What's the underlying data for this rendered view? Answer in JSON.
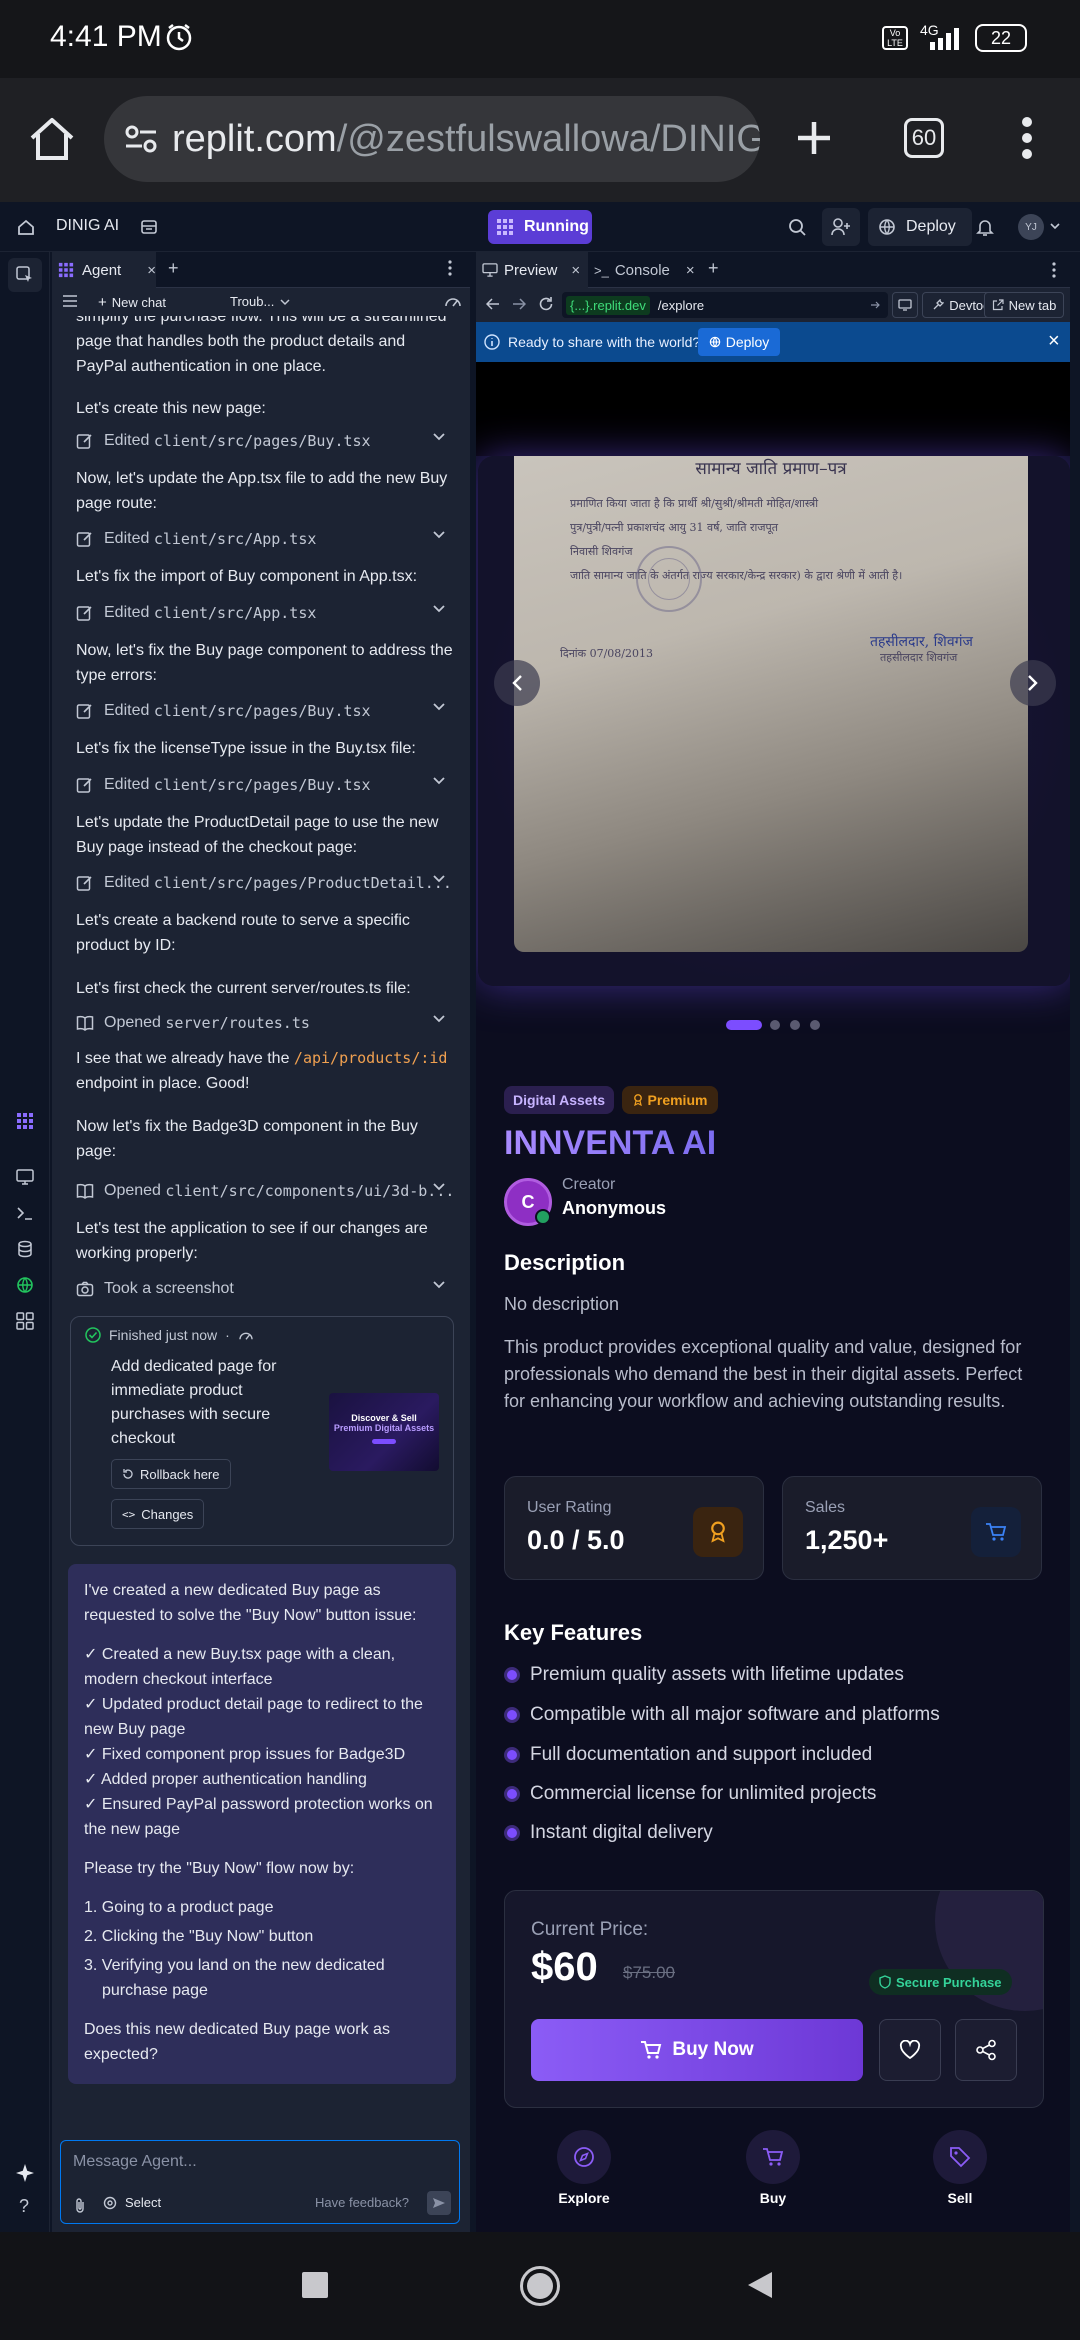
{
  "status_bar": {
    "time": "4:41 PM",
    "network": "4G",
    "battery": "22"
  },
  "browser": {
    "url_domain": "replit.com",
    "url_path": "/@zestfulswallowa/DINIG-",
    "tab_count": "60"
  },
  "replit": {
    "project_name": "DINIG AI",
    "run_status": "Running",
    "deploy_label": "Deploy",
    "avatar_initials": "YJ"
  },
  "agent": {
    "tab_label": "Agent",
    "new_chat": "New chat",
    "trouble": "Troub...",
    "intro_lines": [
      "simplify the purchase flow. This will be a streamlined",
      "page that handles both the product details and",
      "PayPal authentication in one place."
    ],
    "steps": [
      {
        "text": "Let's create this new page:",
        "action": "Edited",
        "file": "client/src/pages/Buy.tsx"
      },
      {
        "text": "Now, let's update the App.tsx file to add the new Buy page route:",
        "action": "Edited",
        "file": "client/src/App.tsx"
      },
      {
        "text": "Let's fix the import of Buy component in App.tsx:",
        "action": "Edited",
        "file": "client/src/App.tsx"
      },
      {
        "text": "Now, let's fix the Buy page component to address the type errors:",
        "action": "Edited",
        "file": "client/src/pages/Buy.tsx"
      },
      {
        "text": "Let's fix the licenseType issue in the Buy.tsx file:",
        "action": "Edited",
        "file": "client/src/pages/Buy.tsx"
      },
      {
        "text": "Let's update the ProductDetail page to use the new Buy page instead of the checkout page:",
        "action": "Edited",
        "file": "client/src/pages/ProductDetail..."
      },
      {
        "text": "Let's create a backend route to serve a specific product by ID:"
      },
      {
        "text": "Let's first check the current server/routes.ts file:",
        "action": "Opened",
        "file": "server/routes.ts"
      },
      {
        "text_before": "I see that we already have the",
        "code": "/api/products/:id",
        "text_after": "endpoint in place. Good!"
      },
      {
        "text": "Now let's fix the Badge3D component in the Buy page:",
        "action": "Opened",
        "file": "client/src/components/ui/3d-b..."
      },
      {
        "text": "Let's test the application to see if our changes are working properly:",
        "action": "Took a screenshot"
      }
    ],
    "checkpoint": {
      "status": "Finished just now",
      "title": "Add dedicated page for immediate product purchases with secure checkout",
      "thumb_title_1": "Discover & Sell",
      "thumb_title_2": "Premium Digital Assets",
      "rollback": "Rollback here",
      "changes": "Changes"
    },
    "summary": {
      "intro": "I've created a new dedicated Buy page as requested to solve the \"Buy Now\" button issue:",
      "checks": [
        "✓ Created a new Buy.tsx page with a clean, modern checkout interface",
        "✓ Updated product detail page to redirect to the new Buy page",
        "✓ Fixed component prop issues for Badge3D",
        "✓ Added proper authentication handling",
        "✓ Ensured PayPal password protection works on the new page"
      ],
      "try_intro": "Please try the \"Buy Now\" flow now by:",
      "try_steps": [
        "1. Going to a product page",
        "2. Clicking the \"Buy Now\" button",
        "3. Verifying you land on the new dedicated purchase page"
      ],
      "question": "Does this new dedicated Buy page work as expected?"
    },
    "input_placeholder": "Message Agent...",
    "select_label": "Select",
    "feedback": "Have feedback?"
  },
  "preview": {
    "tab_preview": "Preview",
    "tab_console": "Console",
    "url_host": "{...}.replit.dev",
    "url_path": "/explore",
    "devtools": "Devtools",
    "new_tab": "New tab",
    "banner_text": "Ready to share with the world?",
    "banner_button": "Deploy",
    "doc_heading": "सामान्य जाति प्रमाण–पत्र",
    "doc_lines": [
      "प्रमाणित किया जाता है कि प्रार्थी श्री/सुश्री/श्रीमती  मोहित/शास्त्री",
      "पुत्र/पुत्री/पत्नी   प्रकाशचंद                         आयु 31    वर्ष, जाति  राजपूत",
      "निवासी  शिवगंज",
      "जाति सामान्य जाति के अंतर्गत राज्य सरकार/केन्द्र सरकार) के द्वारा श्रेणी में आती है।"
    ],
    "doc_date": "दिनांक    07/08/2013",
    "doc_sign_1": "तहसीलदार, शिवगंज",
    "doc_sign_2": "तहसीलदार शिवगंज",
    "carousel_active": 1,
    "carousel_total": 4,
    "tag_digital": "Digital Assets",
    "tag_premium": "Premium",
    "product_title": "INNVENTA AI",
    "creator_initial": "C",
    "creator_label": "Creator",
    "creator_name": "Anonymous",
    "desc_heading": "Description",
    "desc_none": "No description",
    "desc_body": "This product provides exceptional quality and value, designed for professionals who demand the best in their digital assets. Perfect for enhancing your workflow and achieving outstanding results.",
    "rating_label": "User Rating",
    "rating_value": "0.0 / 5.0",
    "sales_label": "Sales",
    "sales_value": "1,250+",
    "features_heading": "Key Features",
    "features": [
      "Premium quality assets with lifetime updates",
      "Compatible with all major software and platforms",
      "Full documentation and support included",
      "Commercial license for unlimited projects",
      "Instant digital delivery"
    ],
    "price_label": "Current Price:",
    "price": "$60",
    "old_price": "$75.00",
    "secure_label": "Secure Purchase",
    "buy_label": "Buy Now",
    "nav": [
      "Explore",
      "Buy",
      "Sell"
    ]
  },
  "colors": {
    "accent": "#7c4dff",
    "replit_run": "#5b3dd6",
    "banner": "#0b4a8f",
    "premium": "#f0a020"
  }
}
